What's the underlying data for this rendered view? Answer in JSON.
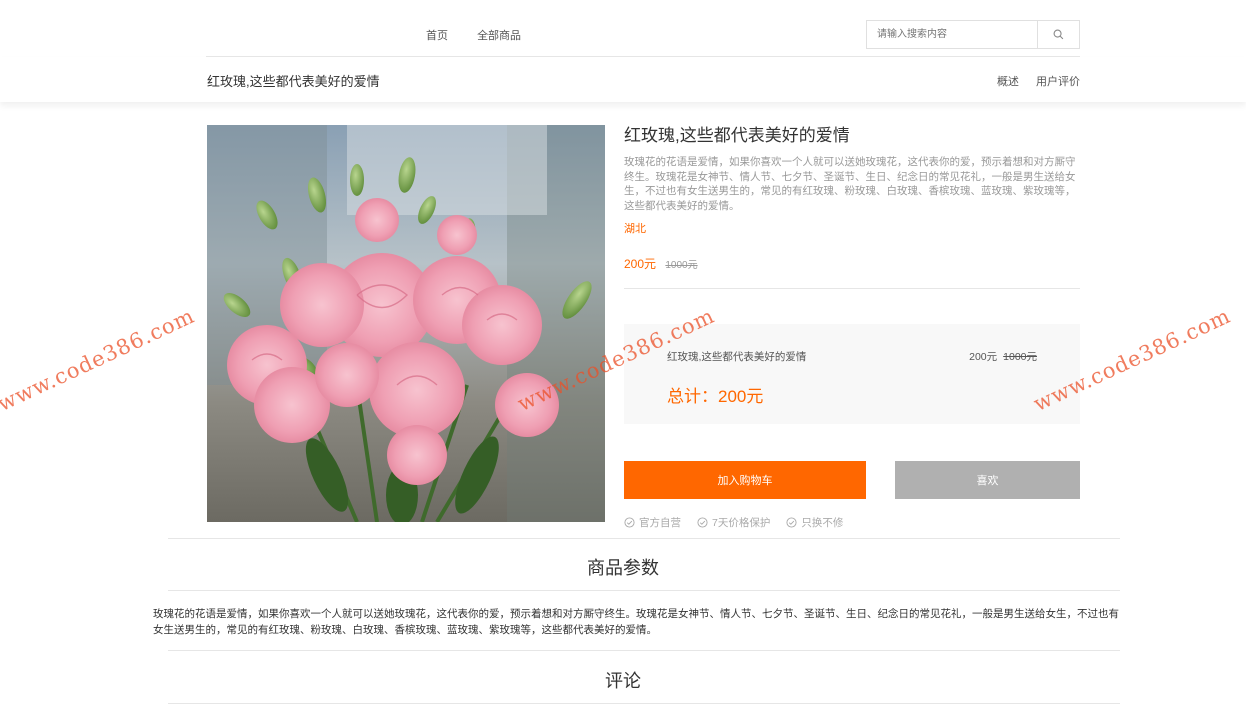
{
  "nav": {
    "links": [
      "首页",
      "全部商品"
    ],
    "search_placeholder": "请输入搜索内容",
    "search_icon": "search-icon"
  },
  "subheader": {
    "title": "红玫瑰,这些都代表美好的爱情",
    "links": [
      "概述",
      "用户评价"
    ]
  },
  "product": {
    "title": "红玫瑰,这些都代表美好的爱情",
    "description": "玫瑰花的花语是爱情，如果你喜欢一个人就可以送她玫瑰花，这代表你的爱，预示着想和对方厮守终生。玫瑰花是女神节、情人节、七夕节、圣诞节、生日、纪念日的常见花礼，一般是男生送给女生，不过也有女生送男生的，常见的有红玫瑰、粉玫瑰、白玫瑰、香槟玫瑰、蓝玫瑰、紫玫瑰等，这些都代表美好的爱情。",
    "location": "湖北",
    "price": "200元",
    "old_price": "1000元"
  },
  "summary": {
    "name": "红玫瑰,这些都代表美好的爱情",
    "price": "200元",
    "old_price": "1000元",
    "total": "总计：200元"
  },
  "actions": {
    "add_to_cart": "加入购物车",
    "like": "喜欢"
  },
  "guarantees": [
    "官方自营",
    "7天价格保护",
    "只换不修"
  ],
  "sections": {
    "params_title": "商品参数",
    "params_text": "玫瑰花的花语是爱情，如果你喜欢一个人就可以送她玫瑰花，这代表你的爱，预示着想和对方厮守终生。玫瑰花是女神节、情人节、七夕节、圣诞节、生日、纪念日的常见花礼，一般是男生送给女生，不过也有女生送男生的，常见的有红玫瑰、粉玫瑰、白玫瑰、香槟玫瑰、蓝玫瑰、紫玫瑰等，这些都代表美好的爱情。",
    "comments_title": "评论"
  },
  "watermark": "www.code386.com",
  "colors": {
    "accent": "#ff6700",
    "like_button": "#b0b0b0",
    "muted_text": "#999999"
  }
}
